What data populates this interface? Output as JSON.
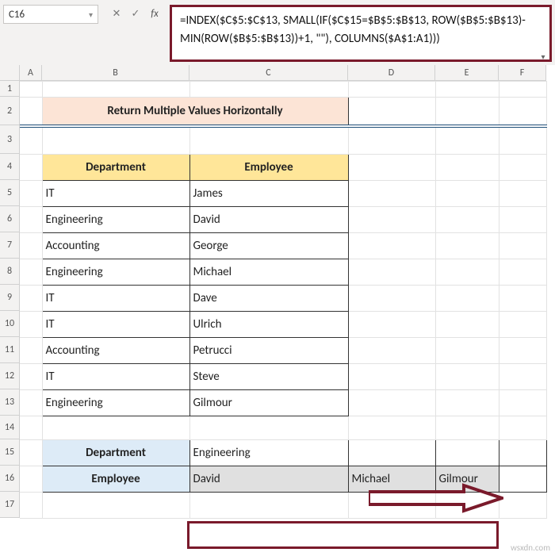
{
  "name_box": {
    "ref": "C16"
  },
  "formula_bar": "=INDEX($C$5:$C$13, SMALL(IF($C$15=$B$5:$B$13, ROW($B$5:$B$13)-MIN(ROW($B$5:$B$13))+1, \"\"), COLUMNS($A$1:A1)))",
  "columns": [
    "A",
    "B",
    "C",
    "D",
    "E",
    "F"
  ],
  "rows": [
    "1",
    "2",
    "3",
    "4",
    "5",
    "6",
    "7",
    "8",
    "9",
    "10",
    "11",
    "12",
    "13",
    "14",
    "15",
    "16",
    "17"
  ],
  "title": "Return Multiple Values Horizontally",
  "headers": {
    "dept": "Department",
    "emp": "Employee"
  },
  "table": [
    {
      "dept": "IT",
      "emp": "James"
    },
    {
      "dept": "Engineering",
      "emp": "David"
    },
    {
      "dept": "Accounting",
      "emp": "George"
    },
    {
      "dept": "Engineering",
      "emp": "Michael"
    },
    {
      "dept": "IT",
      "emp": "Dave"
    },
    {
      "dept": "IT",
      "emp": "Ulrich"
    },
    {
      "dept": "Accounting",
      "emp": "Petrucci"
    },
    {
      "dept": "IT",
      "emp": "Steve"
    },
    {
      "dept": "Engineering",
      "emp": "Gilmour"
    }
  ],
  "lookup": {
    "dept_label": "Department",
    "dept_value": "Engineering",
    "emp_label": "Employee",
    "results": [
      "David",
      "Michael",
      "Gilmour"
    ]
  },
  "watermark": "wsxdn.com",
  "colors": {
    "accent_border": "#7a1a2b",
    "header_fill": "#ffe699",
    "title_fill": "#fce4d6",
    "label_fill": "#ddebf7"
  }
}
